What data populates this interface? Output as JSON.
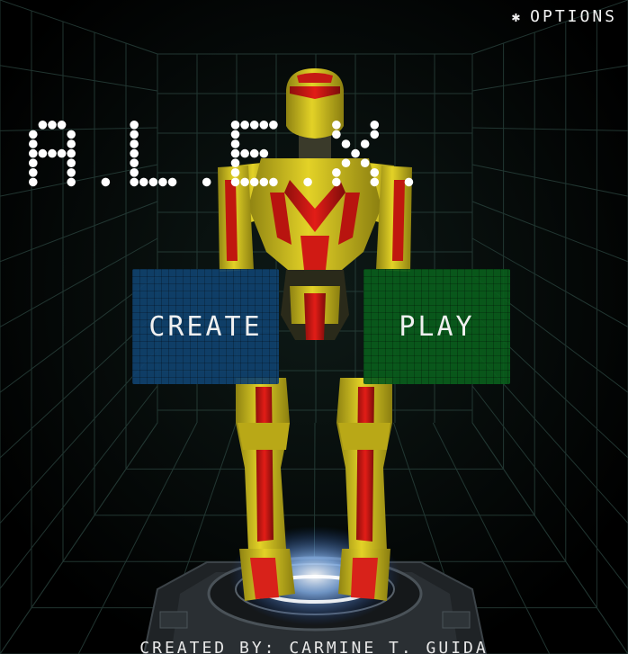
{
  "options": {
    "icon": "gear-icon",
    "label": "OPTIONS"
  },
  "title": {
    "text": "A.L.E.X."
  },
  "buttons": {
    "create_label": "CREATE",
    "play_label": "PLAY"
  },
  "credits": {
    "text": "CREATED BY: CARMINE T. GUIDA"
  },
  "colors": {
    "create_bg": "#10426e",
    "play_bg": "#0a5c1c",
    "robot_yellow": "#d9c81a",
    "robot_red": "#d21a14",
    "grid_line": "#2f4a44",
    "pad_glow": "#6fa8ff"
  }
}
